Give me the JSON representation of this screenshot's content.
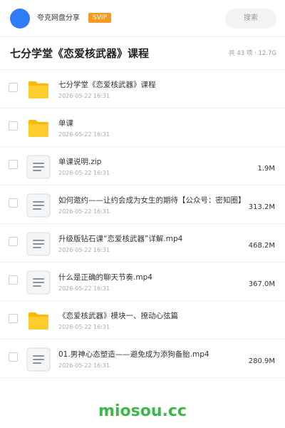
{
  "header": {
    "share_name": "夸克网盘分享",
    "badge": "SVIP",
    "search_placeholder": "搜索"
  },
  "folder": {
    "title": "七分学堂《恋爱核武器》课程",
    "summary": "共 43 项 · 12.7G"
  },
  "files": [
    {
      "name": "七分学堂《恋爱核武器》课程",
      "date": "2026-05-22 16:31",
      "size": "",
      "type": "folder",
      "icon": "folder-icon"
    },
    {
      "name": "单课",
      "date": "2026-05-22 16:31",
      "size": "",
      "type": "folder",
      "icon": "folder-icon"
    },
    {
      "name": "单课说明.zip",
      "date": "2026-05-22 16:31",
      "size": "1.9M",
      "type": "file",
      "icon": "file-icon"
    },
    {
      "name": "如何邀约——让约会成为女生的期待【公众号：密知圈】",
      "date": "2026-05-22 16:31",
      "size": "313.2M",
      "type": "file",
      "icon": "file-icon"
    },
    {
      "name": "升级版钻石课“恋爱核武器”详解.mp4",
      "date": "2026-05-22 16:31",
      "size": "468.2M",
      "type": "file",
      "icon": "file-icon"
    },
    {
      "name": "什么是正确的聊天节奏.mp4",
      "date": "2026-05-22 16:31",
      "size": "367.0M",
      "type": "file",
      "icon": "file-icon"
    },
    {
      "name": "《恋爱核武器》模块一、撩动心弦篇",
      "date": "2026-05-22 16:31",
      "size": "",
      "type": "folder",
      "icon": "folder-icon"
    },
    {
      "name": "01.男神心态塑造——避免成为添狗备胎.mp4",
      "date": "2026-05-22 16:31",
      "size": "280.9M",
      "type": "file",
      "icon": "file-icon"
    }
  ],
  "footer": {
    "brand": "miosou.cc"
  },
  "colors": {
    "accent_blue": "#2f7cf6",
    "svip_orange": "#f59a23",
    "folder_yellow": "#ffc400",
    "brand_green": "#3cb84a"
  }
}
